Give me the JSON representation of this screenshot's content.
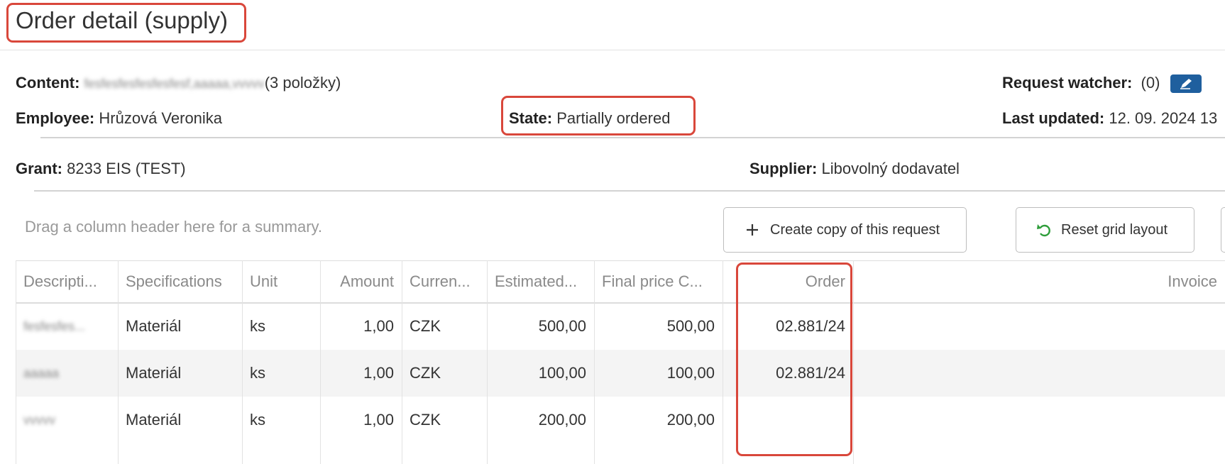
{
  "page": {
    "title": "Order detail (supply)"
  },
  "info": {
    "content_label": "Content:",
    "content_value": "fesfesfesfesfesfesf,aaaaa,vvvvv",
    "content_count": "(3 položky)",
    "employee_label": "Employee:",
    "employee_value": "Hrůzová Veronika",
    "state_label": "State:",
    "state_value": "Partially ordered",
    "watcher_label": "Request watcher:",
    "watcher_value": "(0)",
    "updated_label": "Last updated:",
    "updated_value": "12. 09. 2024 13",
    "grant_label": "Grant:",
    "grant_value": "8233 EIS (TEST)",
    "supplier_label": "Supplier:",
    "supplier_value": "Libovolný dodavatel"
  },
  "toolbar": {
    "group_hint": "Drag a column header here for a summary.",
    "copy_label": "Create copy of this request",
    "reset_label": "Reset grid layout"
  },
  "grid": {
    "columns": [
      "Descripti...",
      "Specifications",
      "Unit",
      "Amount",
      "Curren...",
      "Estimated...",
      "Final price C...",
      "Order",
      "Invoice"
    ],
    "rows": [
      [
        "fesfesfes...",
        "Materiál",
        "ks",
        "1,00",
        "CZK",
        "500,00",
        "500,00",
        "02.881/24",
        ""
      ],
      [
        "aaaaa",
        "Materiál",
        "ks",
        "1,00",
        "CZK",
        "100,00",
        "100,00",
        "02.881/24",
        ""
      ],
      [
        "vvvvv",
        "Materiál",
        "ks",
        "1,00",
        "CZK",
        "200,00",
        "200,00",
        "",
        ""
      ]
    ]
  },
  "colors": {
    "highlight": "#d9473b",
    "edit_button": "#1f5f9e",
    "alt_row": "#f4f4f4"
  },
  "icons": {
    "copy": "plus-icon",
    "reset": "undo-icon",
    "edit": "pencil-icon"
  }
}
